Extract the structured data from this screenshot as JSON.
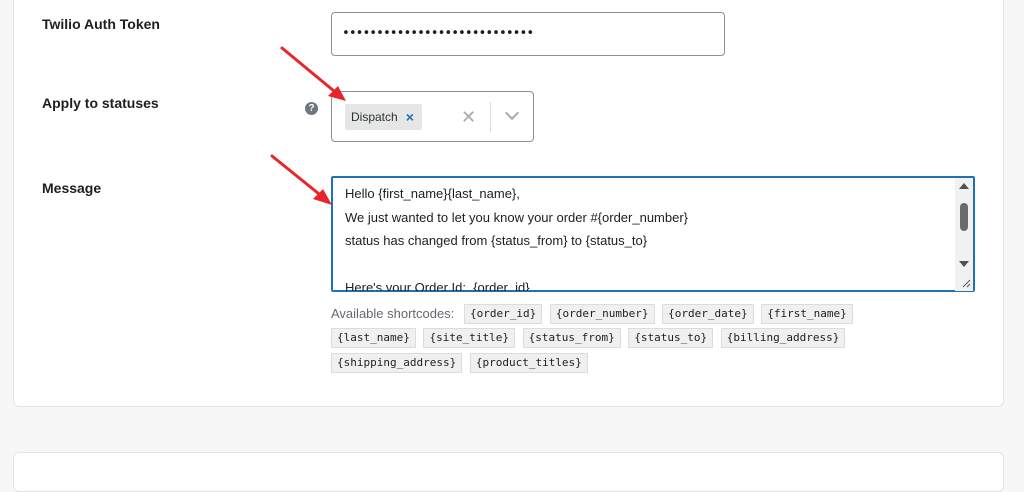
{
  "auth_token": {
    "label": "Twilio Auth Token",
    "value": "••••••••••••••••••••••••••••"
  },
  "statuses": {
    "label": "Apply to statuses",
    "help_icon": "question-circle-icon",
    "selected_chip": "Dispatch",
    "chip_remove": "×",
    "clear": "✕"
  },
  "message": {
    "label": "Message",
    "lines": [
      "Hello {first_name}{last_name},",
      "We just wanted to let you know your order #{order_number}",
      "status has changed from {status_from} to {status_to}",
      "",
      "Here's your Order Id:  {order_id}"
    ]
  },
  "shortcodes": {
    "label": "Available shortcodes:",
    "codes": [
      "{order_id}",
      "{order_number}",
      "{order_date}",
      "{first_name}",
      "{last_name}",
      "{site_title}",
      "{status_from}",
      "{status_to}",
      "{billing_address}",
      "{shipping_address}",
      "{product_titles}"
    ]
  },
  "colors": {
    "accent": "#2271b1",
    "annotation_arrow": "#e8262a"
  }
}
